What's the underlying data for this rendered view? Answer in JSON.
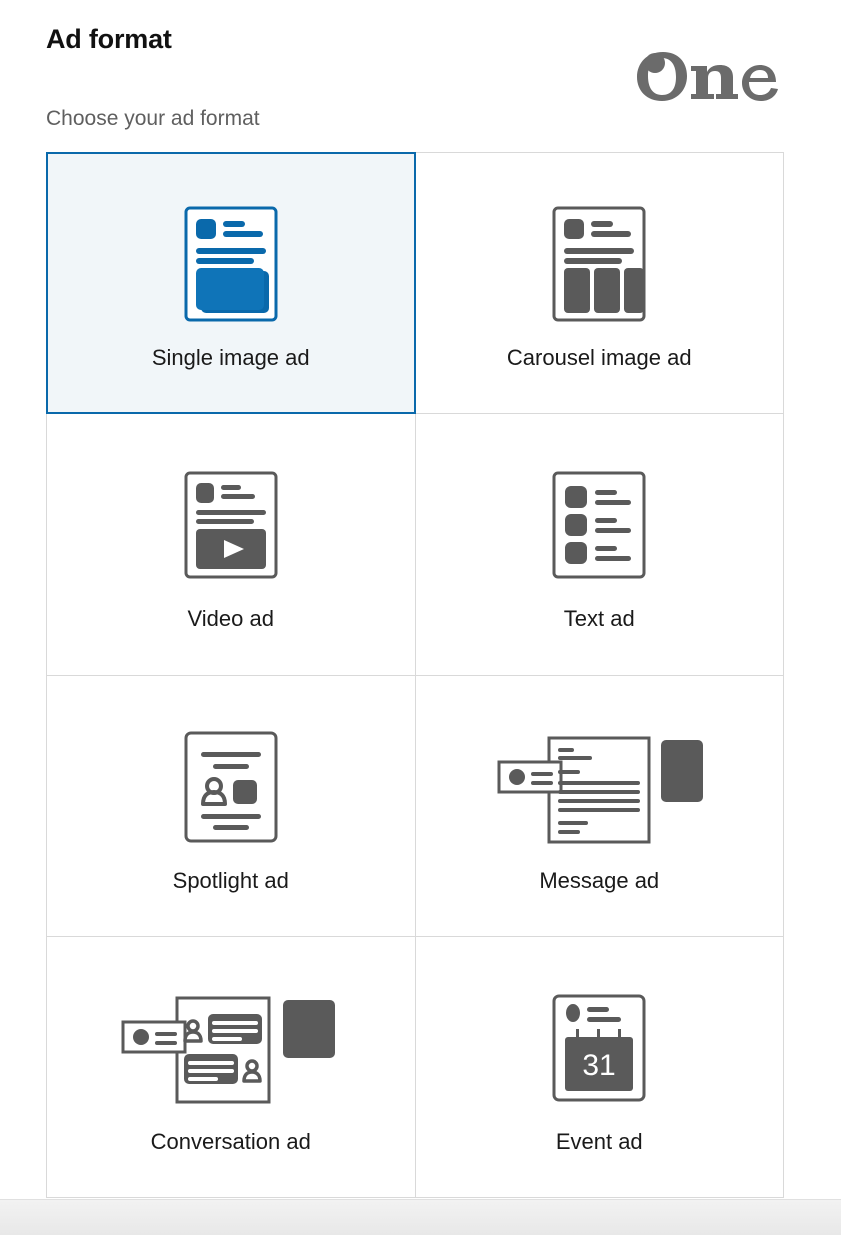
{
  "header": {
    "title": "Ad format",
    "subtitle": "Choose your ad format",
    "logo_text": "One",
    "logo_color": "#6b6b6b"
  },
  "theme": {
    "selected_border": "#0a69ab",
    "selected_background": "#f1f6f9",
    "icon_gray": "#5a5a5a",
    "icon_blue": "#0a69ab",
    "grid_line": "#d9d9d9",
    "label_color": "#1a1a1a"
  },
  "formats": [
    {
      "id": "single-image-ad",
      "label": "Single image ad",
      "icon": "single-image-ad-icon",
      "selected": true
    },
    {
      "id": "carousel-image-ad",
      "label": "Carousel image ad",
      "icon": "carousel-image-ad-icon",
      "selected": false
    },
    {
      "id": "video-ad",
      "label": "Video ad",
      "icon": "video-ad-icon",
      "selected": false
    },
    {
      "id": "text-ad",
      "label": "Text ad",
      "icon": "text-ad-icon",
      "selected": false
    },
    {
      "id": "spotlight-ad",
      "label": "Spotlight ad",
      "icon": "spotlight-ad-icon",
      "selected": false
    },
    {
      "id": "message-ad",
      "label": "Message ad",
      "icon": "message-ad-icon",
      "selected": false
    },
    {
      "id": "conversation-ad",
      "label": "Conversation ad",
      "icon": "conversation-ad-icon",
      "selected": false
    },
    {
      "id": "event-ad",
      "label": "Event ad",
      "icon": "event-ad-icon",
      "selected": false
    }
  ],
  "icon_details": {
    "event_calendar_day": "31"
  }
}
